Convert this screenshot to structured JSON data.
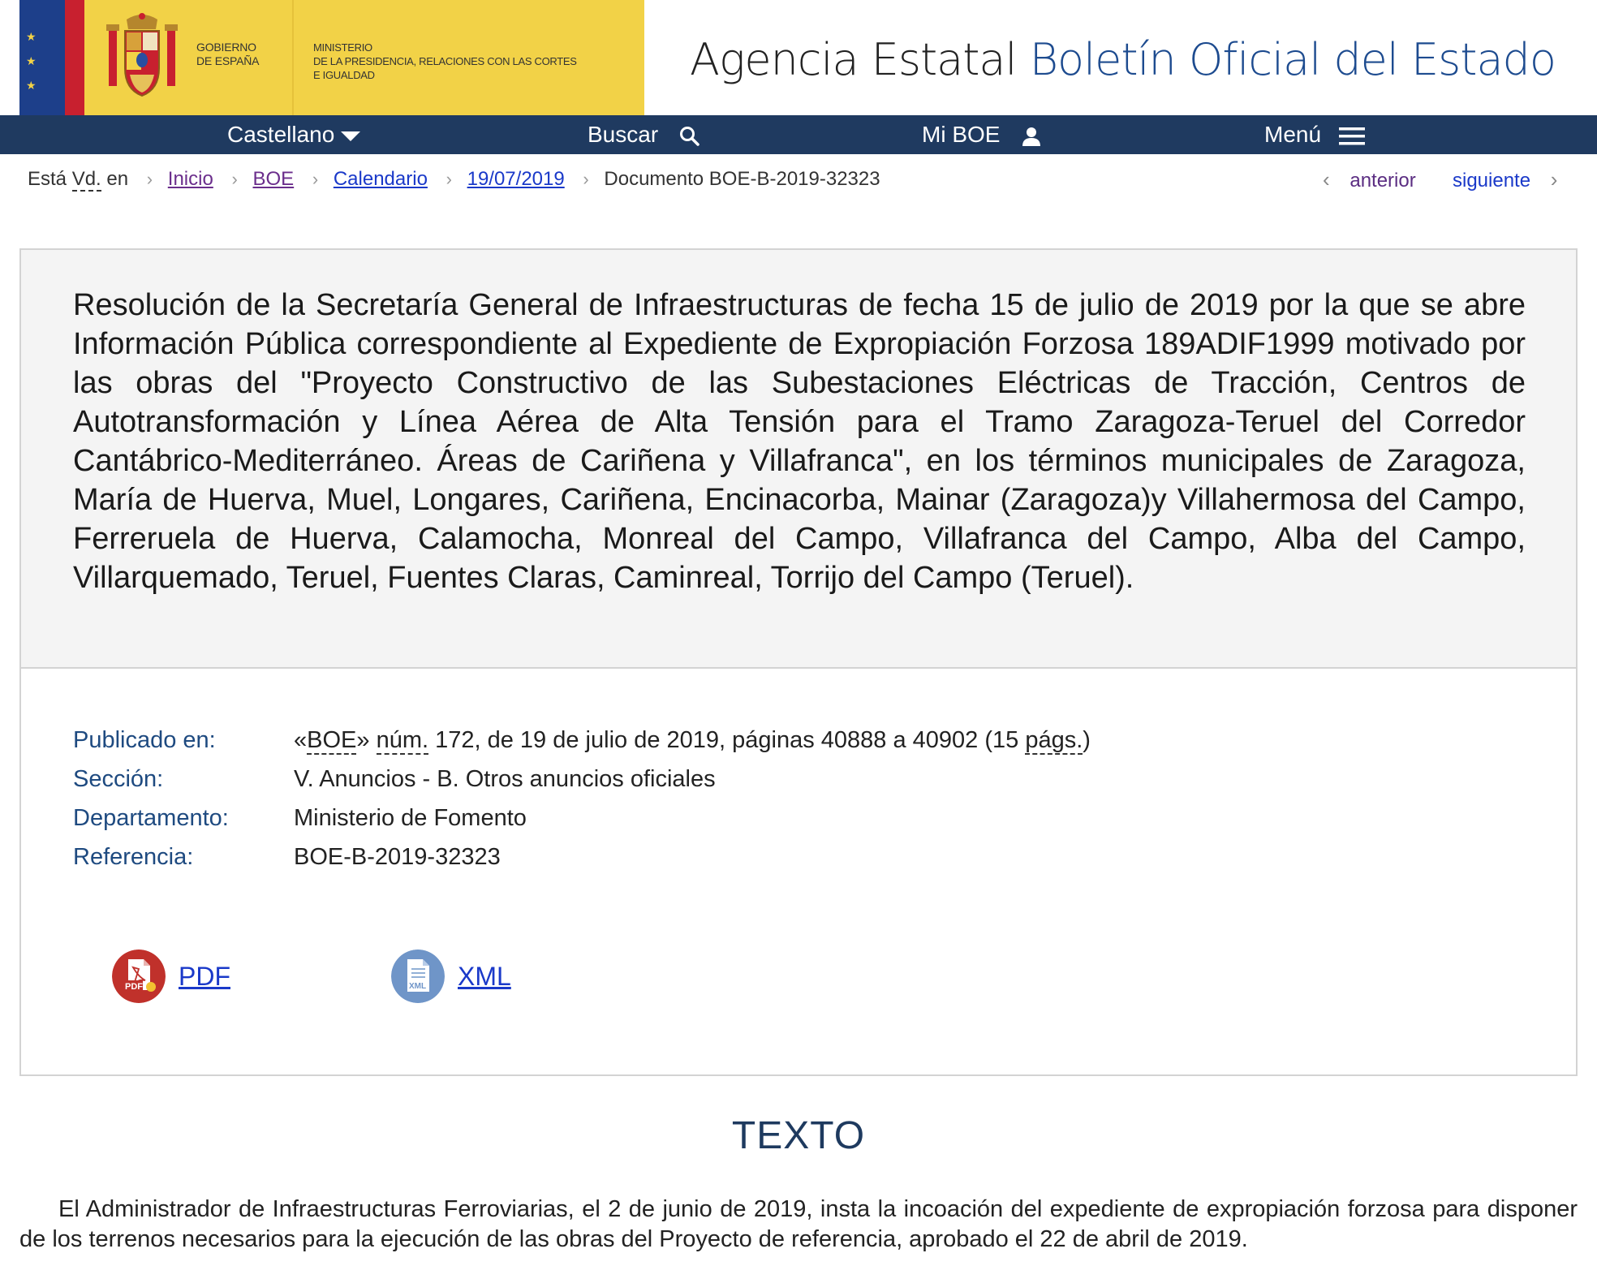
{
  "header": {
    "gov_line1": "Gobierno",
    "gov_line2": "de España",
    "ministry_line1": "Ministerio",
    "ministry_line2": "de la Presidencia, Relaciones con las Cortes",
    "ministry_line3": "e Igualdad",
    "agency_prefix": "Agencia Estatal",
    "agency_name": "Boletín Oficial del Estado"
  },
  "nav": {
    "language": "Castellano",
    "search": "Buscar",
    "my_boe": "Mi BOE",
    "menu": "Menú"
  },
  "breadcrumb": {
    "prefix_a": "Está ",
    "prefix_abbr": "Vd.",
    "prefix_b": " en",
    "items": [
      "Inicio",
      "BOE",
      "Calendario",
      "19/07/2019"
    ],
    "current": "Documento BOE-B-2019-32323"
  },
  "pager": {
    "previous": "anterior",
    "next": "siguiente"
  },
  "document": {
    "title": "Resolución de la Secretaría General de Infraestructuras de fecha 15 de julio de 2019 por la que se abre Información Pública correspondiente al Expediente de Expropiación Forzosa 189ADIF1999 motivado por las obras del \"Proyecto Constructivo de las Subestaciones Eléctricas de Tracción, Centros de Autotransformación y Línea Aérea de Alta Tensión para el Tramo Zaragoza-Teruel del Corredor Cantábrico-Mediterráneo. Áreas de Cariñena y Villafranca\", en los términos municipales de Zaragoza, María de Huerva, Muel, Longares, Cariñena, Encinacorba, Mainar (Zaragoza)y Villahermosa del Campo, Ferreruela de Huerva, Calamocha, Monreal del Campo, Villafranca del Campo, Alba del Campo, Villarquemado, Teruel, Fuentes Claras, Caminreal, Torrijo del Campo (Teruel).",
    "meta": {
      "published_label": "Publicado en:",
      "published_pre": "«",
      "published_boe": "BOE",
      "published_mid": "» ",
      "published_num": "núm.",
      "published_rest": " 172, de 19 de julio de 2019, páginas 40888 a 40902 (15 ",
      "published_pags": "págs.",
      "published_end": ")",
      "section_label": "Sección:",
      "section_value": "V. Anuncios - B. Otros anuncios oficiales",
      "department_label": "Departamento:",
      "department_value": "Ministerio de Fomento",
      "reference_label": "Referencia:",
      "reference_value": "BOE-B-2019-32323"
    },
    "downloads": {
      "pdf": "PDF",
      "pdf_badge": "PDF",
      "xml": "XML",
      "xml_badge": "XML"
    }
  },
  "texto": {
    "heading": "TEXTO",
    "paragraph1": "El Administrador de Infraestructuras Ferroviarias, el 2 de junio de 2019, insta la incoación del expediente de expropiación forzosa para disponer de los terrenos necesarios para la ejecución de las obras del Proyecto de referencia, aprobado el 22 de abril de 2019."
  },
  "colors": {
    "gov_yellow": "#f2d247",
    "nav_blue": "#1f3a60",
    "label_blue": "#1e4a80",
    "link_blue": "#1a39c9",
    "visited_purple": "#6b2e8c",
    "pdf_red": "#c0312b",
    "xml_blue": "#6f95c8"
  }
}
